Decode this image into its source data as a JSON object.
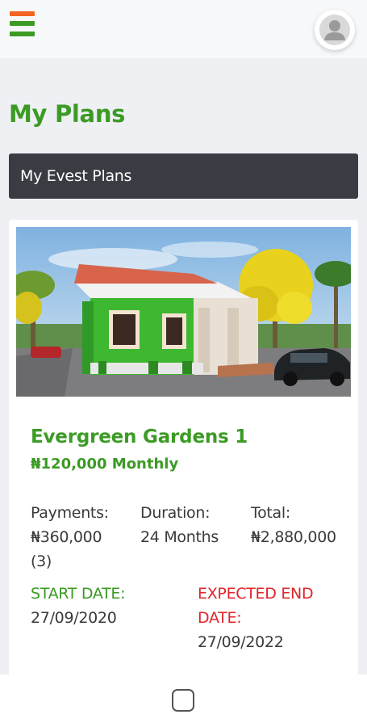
{
  "header": {
    "menu_icon": "hamburger-icon",
    "menu_colors": [
      "#f26522",
      "#ffffff",
      "#3b9b24"
    ],
    "avatar_icon": "user-avatar-icon"
  },
  "page": {
    "title": "My Plans",
    "section_label": "My Evest Plans"
  },
  "plan": {
    "image_icon": "house-photo",
    "name": "Evergreen Gardens 1",
    "price": "₦120,000 Monthly",
    "payments_label": "Payments:",
    "payments_value": "₦360,000",
    "payments_count": "(3)",
    "duration_label": "Duration:",
    "duration_value": "24 Months",
    "total_label": "Total:",
    "total_value": "₦2,880,000",
    "start_label": "START DATE:",
    "start_value": "27/09/2020",
    "end_label_line1": "EXPECTED END",
    "end_label_line2": "DATE:",
    "end_value": "27/09/2022"
  },
  "colors": {
    "brand_green": "#3b9b24",
    "accent_orange": "#f26522",
    "end_date_red": "#e0252b",
    "section_bar": "#393d43"
  },
  "navbar": {
    "home_icon": "home-button-icon"
  }
}
